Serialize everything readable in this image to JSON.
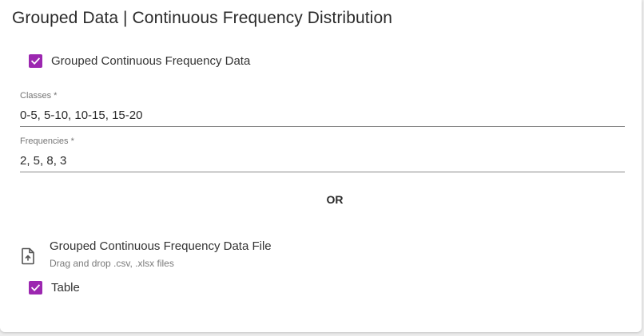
{
  "header": {
    "title": "Grouped Data | Continuous Frequency Distribution"
  },
  "options": {
    "grouped_data_checkbox": {
      "label": "Grouped Continuous Frequency Data",
      "checked": true
    },
    "table_checkbox": {
      "label": "Table",
      "checked": true
    }
  },
  "fields": {
    "classes": {
      "label": "Classes *",
      "value": "0-5, 5-10, 10-15, 15-20"
    },
    "frequencies": {
      "label": "Frequencies *",
      "value": "2, 5, 8, 3"
    }
  },
  "divider": {
    "text": "OR"
  },
  "file_upload": {
    "icon": "file-upload-icon",
    "title": "Grouped Continuous Frequency Data File",
    "hint": "Drag and drop .csv, .xlsx files"
  },
  "colors": {
    "accent": "#9c27b0",
    "underline": "#8a8a8a",
    "background": "#ececec",
    "card": "#ffffff"
  }
}
